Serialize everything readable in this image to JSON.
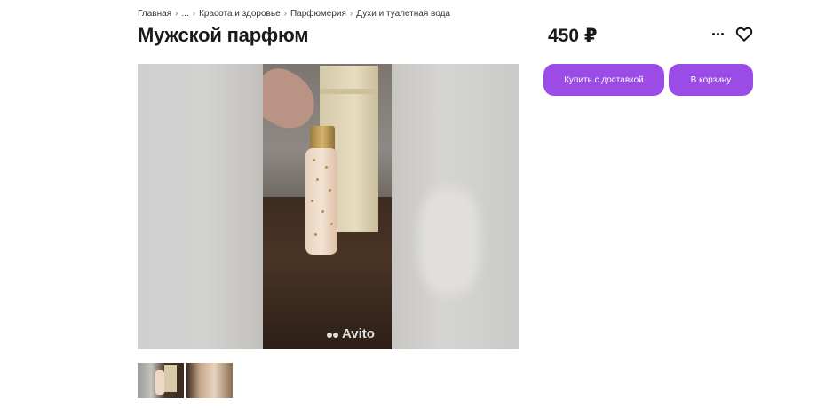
{
  "breadcrumb": {
    "items": [
      "Главная",
      "...",
      "Красота и здоровье",
      "Парфюмерия",
      "Духи и туалетная вода"
    ],
    "separator": "›"
  },
  "product": {
    "title": "Мужской парфюм",
    "price": "450 ₽"
  },
  "actions": {
    "buy_delivery_label": "Купить с доставкой",
    "add_to_cart_label": "В корзину",
    "more_icon": "more-horizontal-icon",
    "favorite_icon": "heart-outline-icon"
  },
  "gallery": {
    "watermark": "Avito",
    "thumbnail_count": 2,
    "active_thumbnail": 1
  },
  "colors": {
    "accent": "#9b4be6",
    "thumb_active": "#33a0e0"
  }
}
